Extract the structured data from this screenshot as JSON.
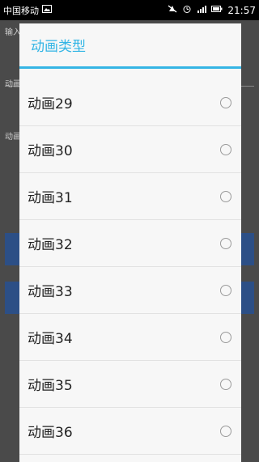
{
  "status_bar": {
    "carrier": "中国移动",
    "time": "21:57"
  },
  "background": {
    "label_1": "输入",
    "label_2": "动画",
    "label_3": "动画"
  },
  "dialog": {
    "title": "动画类型",
    "items": [
      {
        "label": "动画29",
        "selected": false
      },
      {
        "label": "动画30",
        "selected": false
      },
      {
        "label": "动画31",
        "selected": false
      },
      {
        "label": "动画32",
        "selected": false
      },
      {
        "label": "动画33",
        "selected": false
      },
      {
        "label": "动画34",
        "selected": false
      },
      {
        "label": "动画35",
        "selected": false
      },
      {
        "label": "动画36",
        "selected": false
      }
    ]
  },
  "colors": {
    "accent": "#33b5e5",
    "background_button": "#2c4f86"
  }
}
